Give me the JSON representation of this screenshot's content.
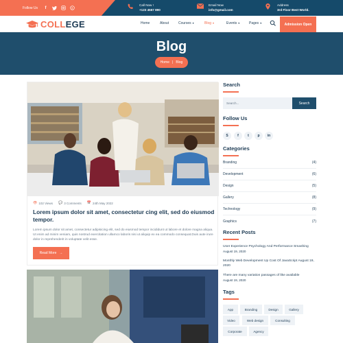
{
  "topbar": {
    "follow_label": "Follow Us",
    "socials": [
      "facebook-icon",
      "twitter-icon",
      "instagram-icon",
      "pinterest-icon"
    ],
    "call": {
      "label": "Call Now !",
      "value": "+123 4567 890"
    },
    "email": {
      "label": "Email Now",
      "value": "info@gmail.com"
    },
    "address": {
      "label": "Address",
      "value": "3rd Floor Best World."
    }
  },
  "brand": {
    "part1": "COLL",
    "part2": "EGE",
    "accent": "#f47052",
    "dark": "#1f4e6c"
  },
  "nav": {
    "items": [
      {
        "label": "Home"
      },
      {
        "label": "About"
      },
      {
        "label": "Courses"
      },
      {
        "label": "Blog"
      },
      {
        "label": "Events"
      },
      {
        "label": "Pages"
      }
    ],
    "admission": "Admission Open"
  },
  "banner": {
    "title": "Blog",
    "crumb_home": "Home",
    "crumb_sep": "|",
    "crumb_current": "Blog"
  },
  "post": {
    "views": "102 Views",
    "comments": "3 Comments",
    "date": "24th May 2022",
    "title": "Lorem ipsum dolor sit amet, consectetur cing elit, sed do eiusmod tempor.",
    "excerpt": "Lorem ipsum dolor sit amet, consectetur adipisicing elit, sed do eiusmod tempor incididunt ut labore et dolore magna aliqua. Ut enim ad minim veniam, quis nostrud exercitation ullamco laboris nisi ut aliquip ex ea commodo consequat.Duis aute irure dolor in reprehenderit in voluptate velit esse.",
    "read_more": "Read More"
  },
  "sidebar": {
    "search_title": "Search",
    "search_placeholder": "Search...",
    "search_button": "Search",
    "follow_title": "Follow Us",
    "follow_icons": [
      "skype-icon",
      "facebook-icon",
      "twitter-icon",
      "pinterest-icon",
      "linkedin-icon"
    ],
    "categories_title": "Categories",
    "categories": [
      {
        "name": "Branding",
        "count": "(4)"
      },
      {
        "name": "Development",
        "count": "(6)"
      },
      {
        "name": "Design",
        "count": "(5)"
      },
      {
        "name": "Gallery",
        "count": "(8)"
      },
      {
        "name": "Technology",
        "count": "(9)"
      },
      {
        "name": "Graphics",
        "count": "(7)"
      }
    ],
    "recent_title": "Recent Posts",
    "recent": [
      {
        "title": "User Experience Psychology And Performance Smashing",
        "date": "August 19, 2020"
      },
      {
        "title": "Monthly Web Development Up Cost Of JavaScript August 19, 2020",
        "date": ""
      },
      {
        "title": "There are many variation passages of like available",
        "date": "August 19, 2020"
      }
    ],
    "tags_title": "Tags",
    "tags": [
      "App",
      "Branding",
      "Design",
      "Gallery",
      "Video",
      "Web design",
      "Consulting",
      "Corporate",
      "Agency"
    ]
  }
}
